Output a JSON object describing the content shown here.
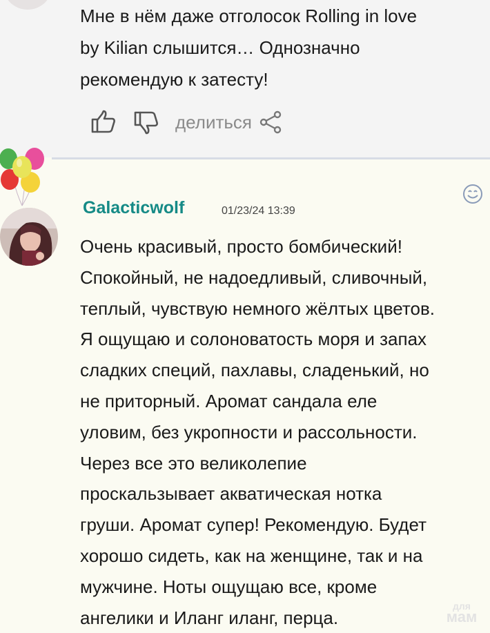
{
  "previous_comment": {
    "text_lines": [
      "Мне в нём даже отголосок Rolling in love",
      "by Kilian слышится… Однозначно",
      "рекомендую к затесту!"
    ],
    "actions": {
      "like_icon": "thumbs-up-icon",
      "dislike_icon": "thumbs-down-icon",
      "share_label": "делиться",
      "share_icon": "share-icon"
    }
  },
  "comment": {
    "username": "Galacticwolf",
    "date": "01/23/24 13:39",
    "reaction_icon": "smiley-icon",
    "decoration_icon": "balloons-icon",
    "text_lines": [
      "Очень красивый, просто бомбический!",
      "Спокойный, не надоедливый, сливочный,",
      "теплый, чувствую немного жёлтых цветов.",
      "Я ощущаю и солоноватость моря и запах",
      "сладких специй, пахлавы, сладенький, но",
      "не приторный. Аромат сандала еле",
      "уловим, без укропности и рассольности.",
      "Через все это великолепие",
      "проскальзывает акватическая нотка",
      "груши. Аромат супер! Рекомендую. Будет",
      "хорошо сидеть, как на женщине, так и на",
      "мужчине. Ноты ощущаю все, кроме",
      "ангелики и Иланг иланг, перца."
    ]
  },
  "watermark": {
    "line1": "для",
    "line2": "мам"
  },
  "colors": {
    "username": "#158a86",
    "divider": "#d7dce5",
    "top_bg": "#f4f4f4",
    "comment_bg": "#fbfbf2"
  }
}
